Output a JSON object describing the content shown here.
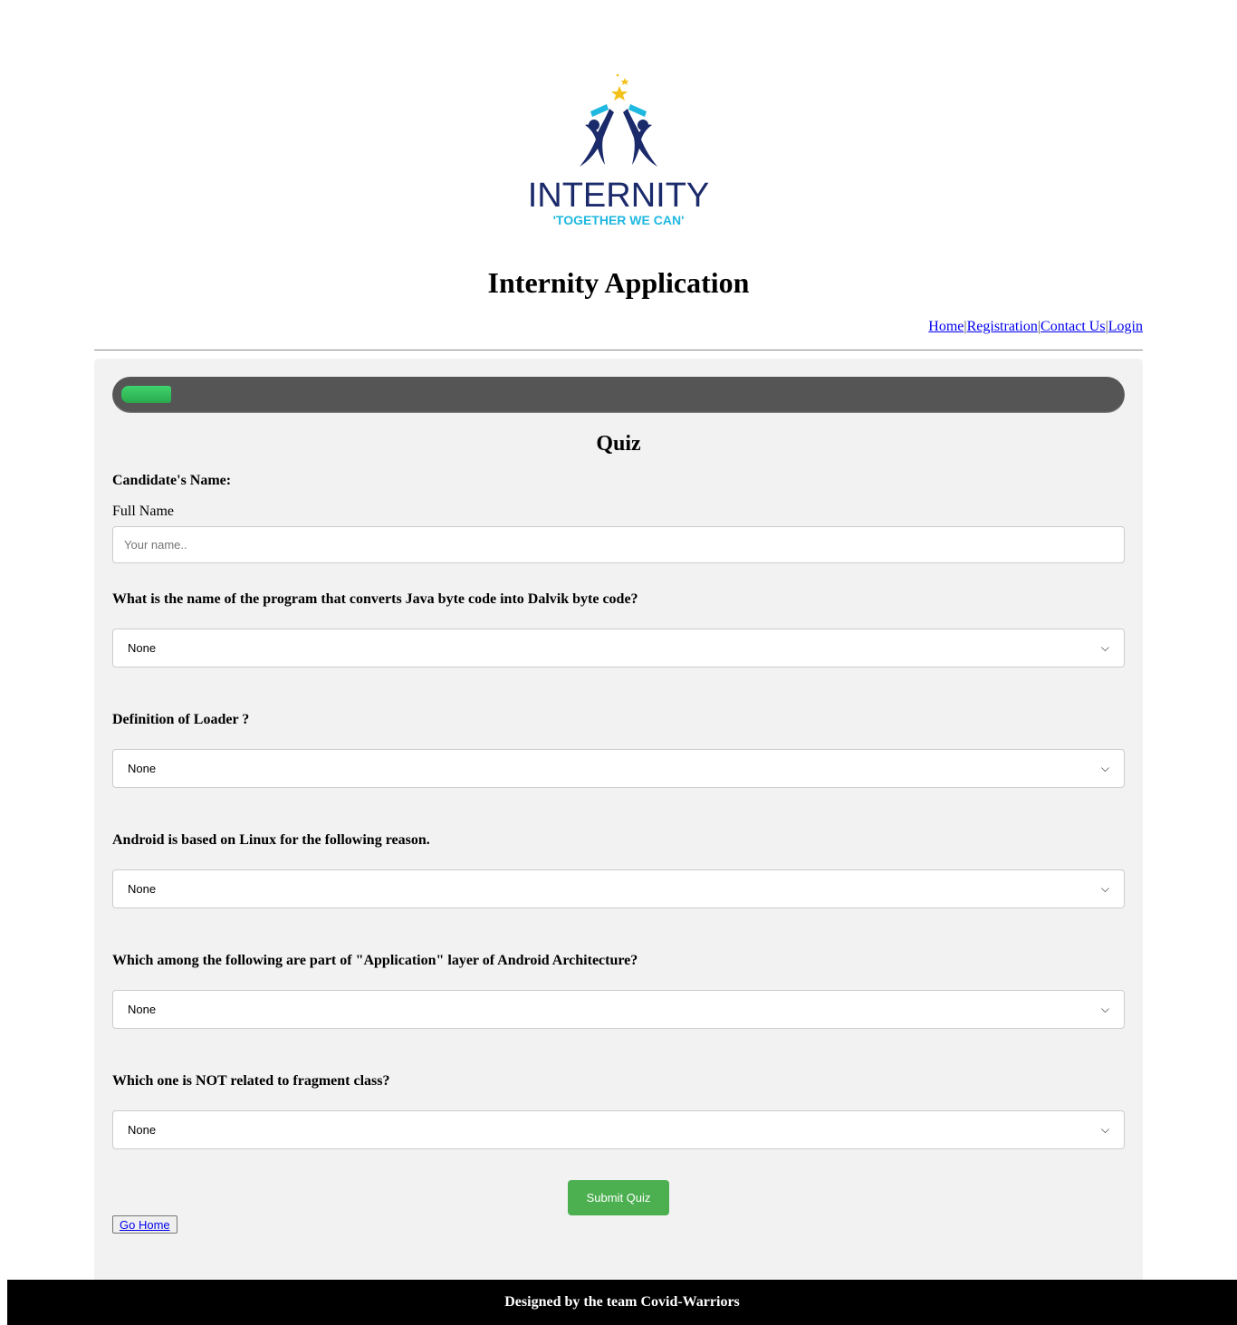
{
  "logo": {
    "wordmark": "INTERNITY",
    "tagline": "'TOGETHER WE CAN'",
    "colors": {
      "navy": "#1b2a6b",
      "cyan": "#1fb8e0",
      "gold": "#f2c21a"
    }
  },
  "header": {
    "title": "Internity Application"
  },
  "nav": {
    "items": [
      "Home",
      "Registration",
      "Contact Us",
      "Login"
    ],
    "separator": "|"
  },
  "quiz": {
    "progress_fraction": 0.05,
    "title": "Quiz",
    "candidate_label": "Candidate's Name:",
    "full_name_label": "Full Name",
    "full_name_placeholder": "Your name..",
    "full_name_value": "",
    "questions": [
      {
        "text": "What is the name of the program that converts Java byte code into Dalvik byte code?",
        "selected": "None"
      },
      {
        "text": "Definition of Loader ?",
        "selected": "None"
      },
      {
        "text": "Android is based on Linux for the following reason.",
        "selected": "None"
      },
      {
        "text": "Which among the following are part of \"Application\" layer of Android Architecture?",
        "selected": "None"
      },
      {
        "text": "Which one is NOT related to fragment class?",
        "selected": "None"
      }
    ],
    "submit_label": "Submit Quiz",
    "go_home_label": "Go Home"
  },
  "footer": {
    "text": "Designed by the team Covid-Warriors"
  },
  "colors": {
    "panel_bg": "#f2f2f2",
    "progress_track": "#555555",
    "progress_fill": "#2ebd55",
    "submit_bg": "#4caf50",
    "link": "#0000ee",
    "footer_bg": "#000000"
  }
}
